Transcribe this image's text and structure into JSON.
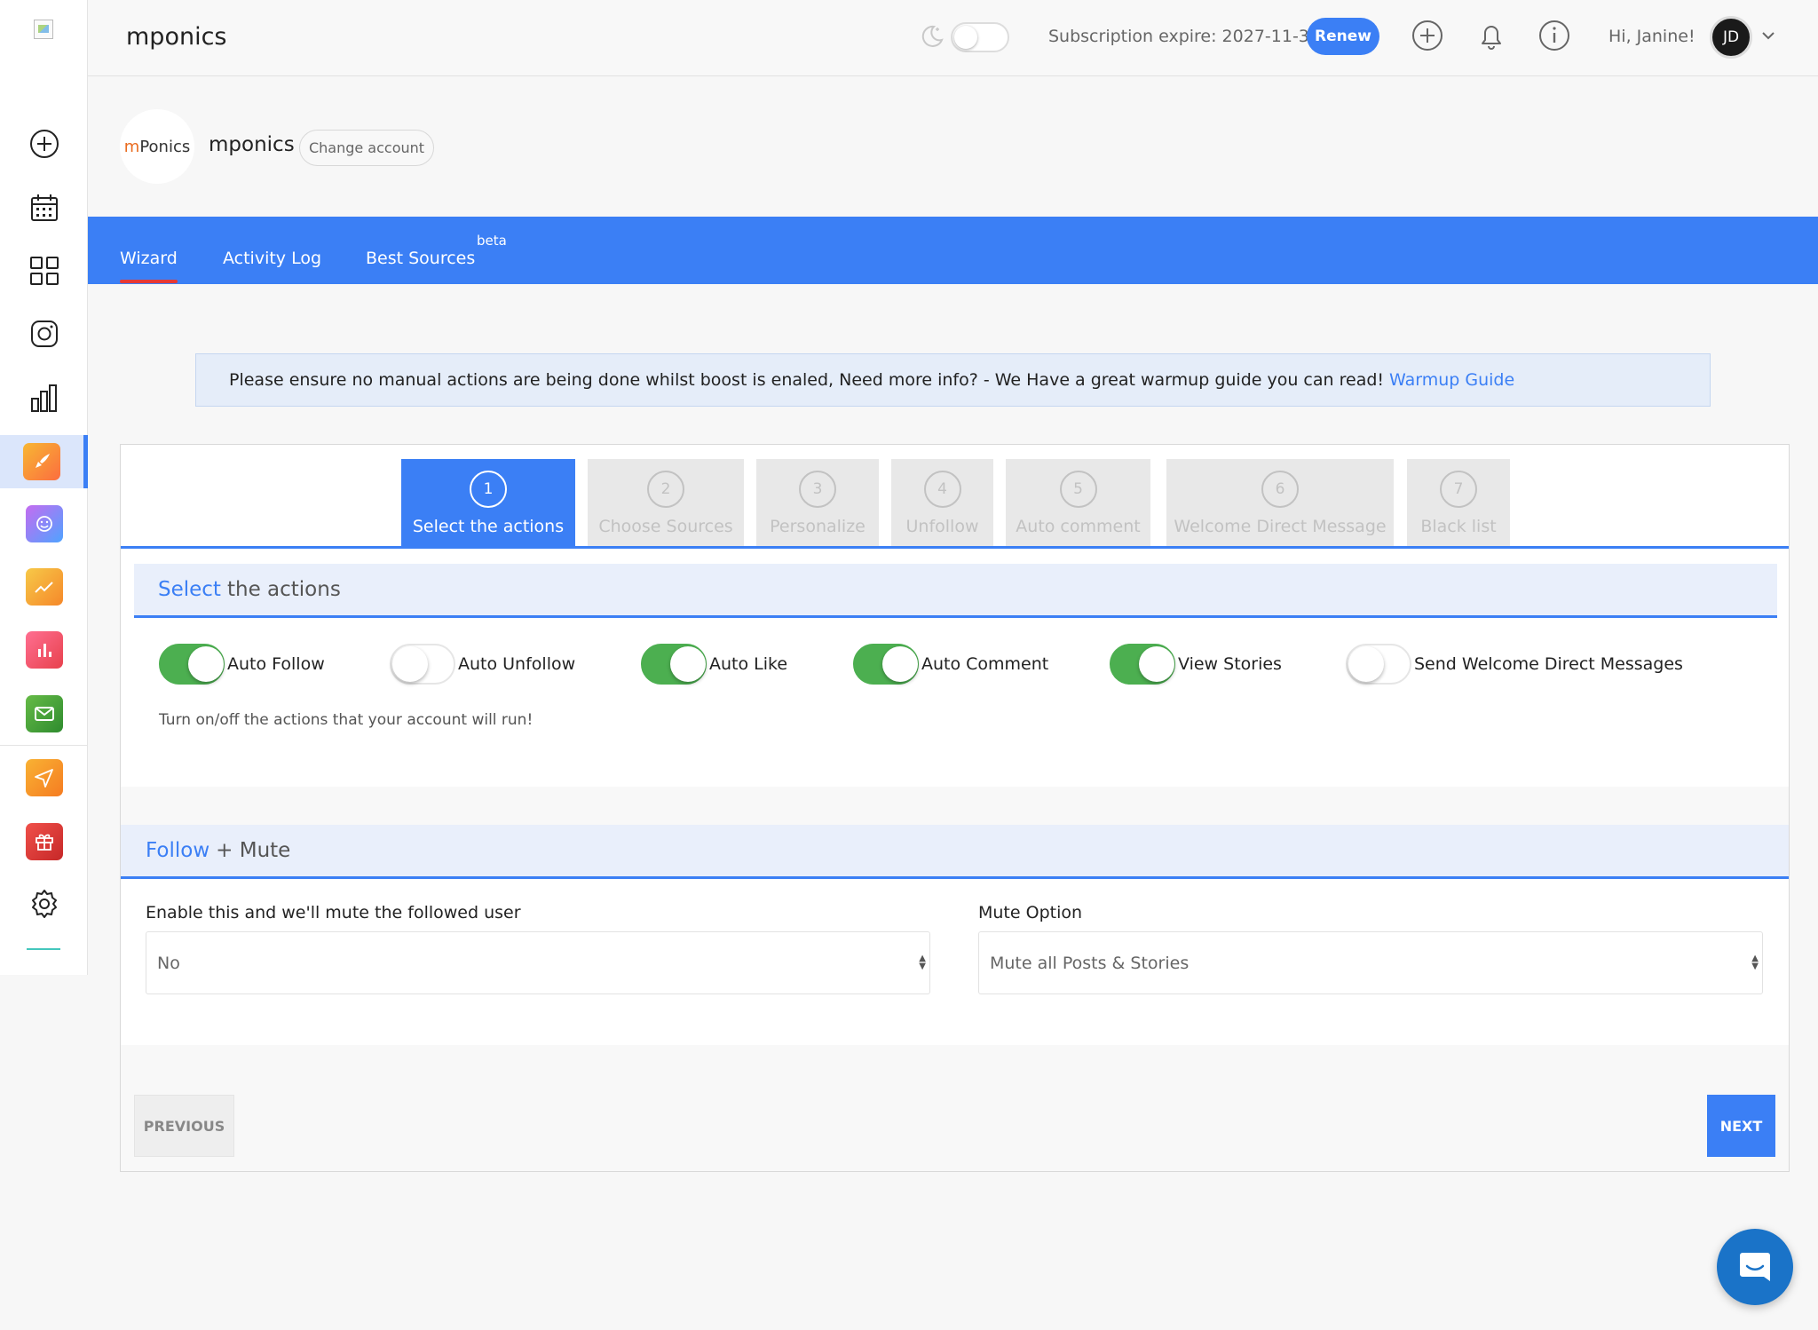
{
  "header": {
    "app_title": "mponics",
    "subscription": "Subscription expire: 2027-11-30",
    "renew_label": "Renew",
    "greeting": "Hi, Janine!",
    "avatar_initials": "JD"
  },
  "sidebar": {
    "items": [
      {
        "name": "add-circle-icon"
      },
      {
        "name": "calendar-icon"
      },
      {
        "name": "grid-icon"
      },
      {
        "name": "instagram-icon"
      },
      {
        "name": "bar-chart-icon"
      },
      {
        "name": "rocket-icon",
        "active": true,
        "color": "#f5a623"
      },
      {
        "name": "smiley-icon",
        "color": "#b45cf6"
      },
      {
        "name": "trend-icon",
        "color": "#f5a623"
      },
      {
        "name": "stats-icon",
        "color": "#f04b6e"
      },
      {
        "name": "mail-icon",
        "color": "#43a047"
      },
      {
        "name": "send-icon",
        "color": "#f5a623"
      },
      {
        "name": "gift-icon",
        "color": "#e53935"
      },
      {
        "name": "settings-icon"
      }
    ]
  },
  "account": {
    "logo_prefix": "m",
    "logo_suffix": "Ponics",
    "name": "mponics",
    "change_label": "Change account"
  },
  "tabs": {
    "wizard": "Wizard",
    "activity_log": "Activity Log",
    "best_sources": "Best Sources",
    "beta": "beta"
  },
  "alert": {
    "text": "Please ensure no manual actions are being done whilst boost is enaled, Need more info? - We Have a great warmup guide you can read!",
    "link": "Warmup Guide"
  },
  "wizard": {
    "steps": [
      {
        "num": "1",
        "label": "Select the actions",
        "active": true
      },
      {
        "num": "2",
        "label": "Choose Sources"
      },
      {
        "num": "3",
        "label": "Personalize"
      },
      {
        "num": "4",
        "label": "Unfollow"
      },
      {
        "num": "5",
        "label": "Auto comment"
      },
      {
        "num": "6",
        "label": "Welcome Direct Message"
      },
      {
        "num": "7",
        "label": "Black list"
      }
    ],
    "section1": {
      "highlight": "Select",
      "rest": "the actions"
    },
    "toggles": [
      {
        "label": "Auto Follow",
        "on": true
      },
      {
        "label": "Auto Unfollow",
        "on": false
      },
      {
        "label": "Auto Like",
        "on": true
      },
      {
        "label": "Auto Comment",
        "on": true
      },
      {
        "label": "View Stories",
        "on": true
      },
      {
        "label": "Send Welcome Direct Messages",
        "on": false
      }
    ],
    "help_text": "Turn on/off the actions that your account will run!",
    "section2": {
      "highlight": "Follow",
      "rest": "+ Mute"
    },
    "mute_enable_label": "Enable this and we'll mute the followed user",
    "mute_enable_value": "No",
    "mute_option_label": "Mute Option",
    "mute_option_value": "Mute all Posts & Stories",
    "prev_label": "PREVIOUS",
    "next_label": "NEXT"
  },
  "colors": {
    "accent": "#3b7ff5",
    "toggle_on": "#4caf50",
    "tab_indicator": "#e53935"
  }
}
